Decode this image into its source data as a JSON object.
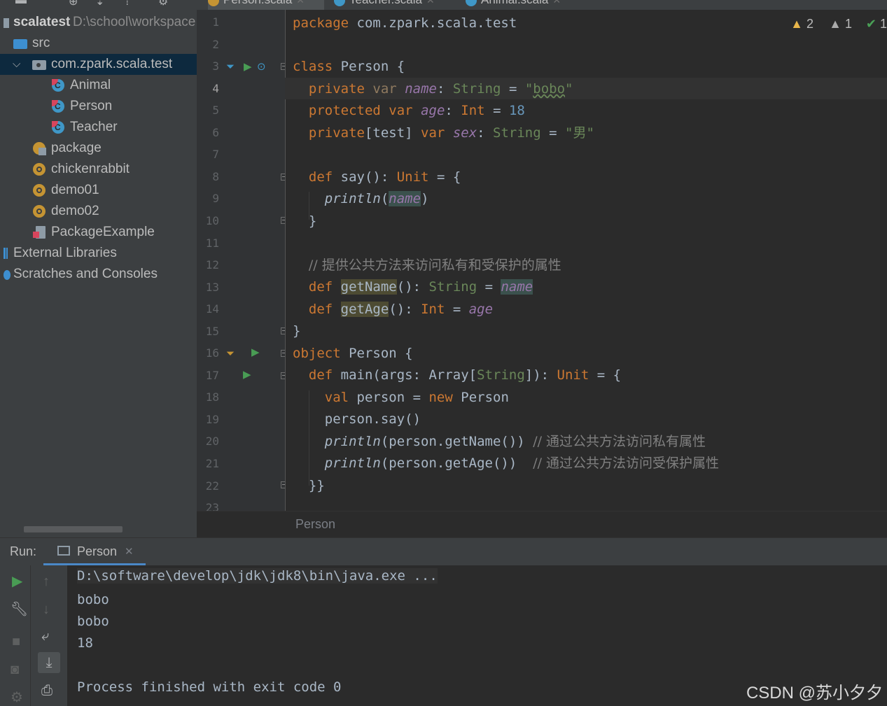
{
  "project": {
    "root": {
      "name": "scalatest",
      "path": "D:\\school\\workspace"
    },
    "items": [
      {
        "label": "src",
        "icon": "folder-icon"
      },
      {
        "label": "com.zpark.scala.test",
        "icon": "package-folder-icon"
      },
      {
        "label": "Animal",
        "icon": "scala-class-icon"
      },
      {
        "label": "Person",
        "icon": "scala-class-icon"
      },
      {
        "label": "Teacher",
        "icon": "scala-class-icon"
      },
      {
        "label": "package",
        "icon": "package-object-icon"
      },
      {
        "label": "chickenrabbit",
        "icon": "scala-object-icon"
      },
      {
        "label": "demo01",
        "icon": "scala-object-icon"
      },
      {
        "label": "demo02",
        "icon": "scala-object-icon"
      },
      {
        "label": "PackageExample",
        "icon": "scala-file-icon"
      },
      {
        "label": "External Libraries",
        "icon": "library-icon"
      },
      {
        "label": "Scratches and Consoles",
        "icon": "scratch-icon"
      }
    ]
  },
  "tabs": [
    "Person.scala",
    "Teacher.scala",
    "Animal.scala"
  ],
  "inspection": {
    "warnings": "2",
    "weak_warnings": "1",
    "typos": "1"
  },
  "editor": {
    "current_line": 4,
    "line_numbers": [
      "1",
      "2",
      "3",
      "4",
      "5",
      "6",
      "7",
      "8",
      "9",
      "10",
      "11",
      "12",
      "13",
      "14",
      "15",
      "16",
      "17",
      "18",
      "19",
      "20",
      "21",
      "22",
      "23"
    ],
    "comments": {
      "c12": "// 提供公共方法来访问私有和受保护的属性",
      "c20": "// 通过公共方法访问私有属性",
      "c21": "// 通过公共方法访问受保护属性"
    },
    "strings": {
      "bobo": "bobo",
      "male": "男"
    },
    "numbers": {
      "age": "18"
    },
    "breadcrumb": "Person"
  },
  "run": {
    "label": "Run:",
    "tab": "Person",
    "console": [
      "D:\\software\\develop\\jdk\\jdk8\\bin\\java.exe ...",
      "bobo",
      "bobo",
      "18",
      "",
      "Process finished with exit code 0"
    ]
  },
  "watermark": "CSDN @苏小夕夕",
  "colors": {
    "background": "#2b2b2b",
    "keyword": "#cc7832",
    "string": "#6a8759",
    "number": "#6897bb",
    "field": "#9876aa",
    "comment": "#808080",
    "selection": "#0d293e",
    "accent": "#4a88c7"
  }
}
